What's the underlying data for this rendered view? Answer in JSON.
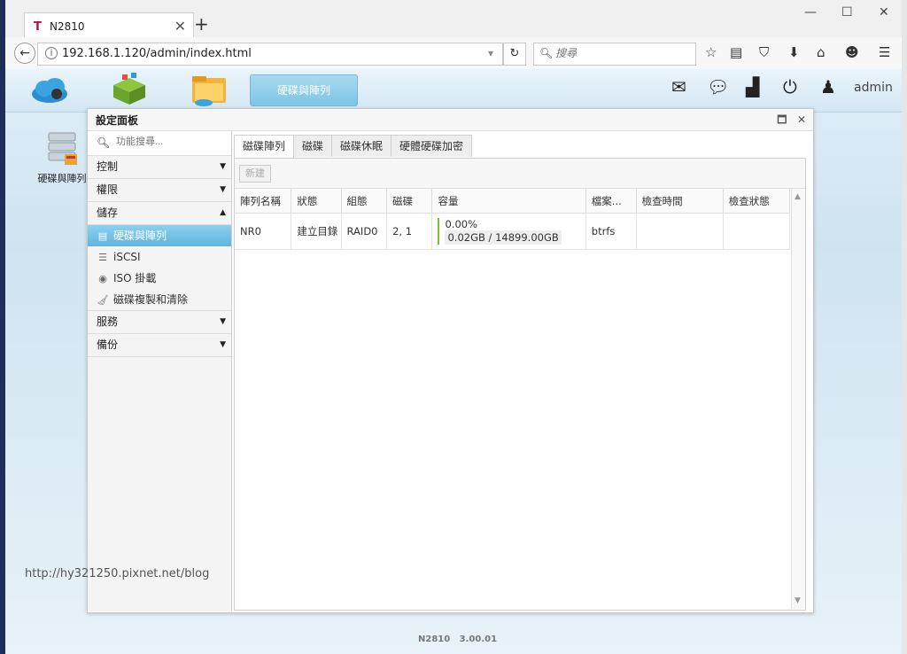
{
  "browser": {
    "tab_title": "N2810",
    "tab_favicon": "T",
    "url": "192.168.1.120/admin/index.html",
    "search_placeholder": "搜尋"
  },
  "topbar": {
    "active_app_label": "硬碟與陣列",
    "user": "admin"
  },
  "desktop": {
    "shortcut_label": "硬碟與陣列"
  },
  "panel": {
    "title": "設定面板",
    "search_placeholder": "功能搜尋...",
    "sections": [
      {
        "label": "控制",
        "arrow": "▼"
      },
      {
        "label": "權限",
        "arrow": "▼"
      },
      {
        "label": "儲存",
        "arrow": "▲"
      },
      {
        "label": "服務",
        "arrow": "▼"
      },
      {
        "label": "備份",
        "arrow": "▼"
      }
    ],
    "storage_items": [
      "硬碟與陣列",
      "iSCSI",
      "ISO 掛載",
      "磁碟複製和清除"
    ]
  },
  "main": {
    "tabs": [
      "磁碟陣列",
      "磁碟",
      "磁碟休眠",
      "硬體硬碟加密"
    ],
    "new_button": "新建",
    "columns": [
      "陣列名稱",
      "狀態",
      "組態",
      "磁碟",
      "容量",
      "檔案...",
      "檢查時間",
      "檢查狀態"
    ],
    "rows": [
      {
        "name": "NR0",
        "status": "建立目錄",
        "config": "RAID0",
        "disks": "2, 1",
        "usage_pct": "0.00%",
        "capacity": "0.02GB / 14899.00GB",
        "fs": "btrfs",
        "check_time": "",
        "check_status": ""
      }
    ]
  },
  "footer": {
    "model": "N2810",
    "version": "3.00.01"
  },
  "watermark": "http://hy321250.pixnet.net/blog"
}
